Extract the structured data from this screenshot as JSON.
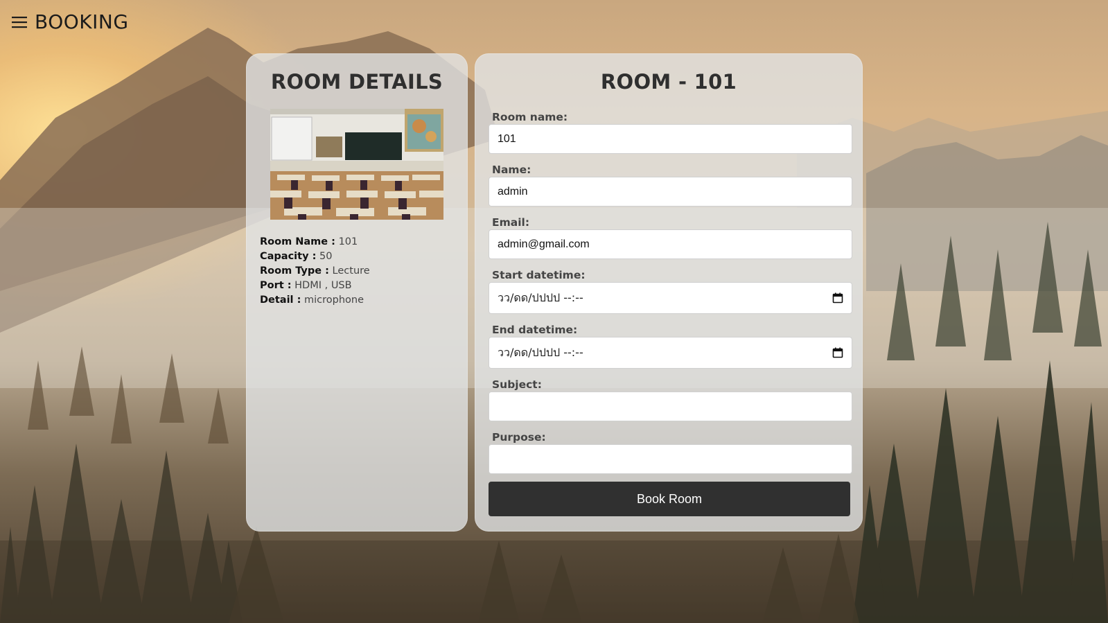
{
  "header": {
    "menu_icon": "hamburger-menu-icon",
    "brand": "BOOKING"
  },
  "details_panel": {
    "title": "ROOM DETAILS",
    "image": "classroom-photo",
    "fields": [
      {
        "key": "Room Name :",
        "value": "101"
      },
      {
        "key": "Capacity :",
        "value": "50"
      },
      {
        "key": "Room Type :",
        "value": "Lecture"
      },
      {
        "key": "Port :",
        "value": "HDMI , USB"
      },
      {
        "key": "Detail :",
        "value": "microphone"
      }
    ]
  },
  "booking_form": {
    "title": "ROOM - 101",
    "room_name_label": "Room name:",
    "room_name_value": "101",
    "name_label": "Name:",
    "name_value": "admin",
    "email_label": "Email:",
    "email_value": "admin@gmail.com",
    "start_label": "Start datetime:",
    "start_value": "วว/ดด/ปปปป --:--",
    "end_label": "End datetime:",
    "end_value": "วว/ดด/ปปปป --:--",
    "subject_label": "Subject:",
    "subject_value": "",
    "purpose_label": "Purpose:",
    "purpose_value": "",
    "submit_label": "Book Room"
  },
  "colors": {
    "button": "#303030",
    "panel": "#e1e4e6",
    "text_dark": "#2f2f2f"
  }
}
